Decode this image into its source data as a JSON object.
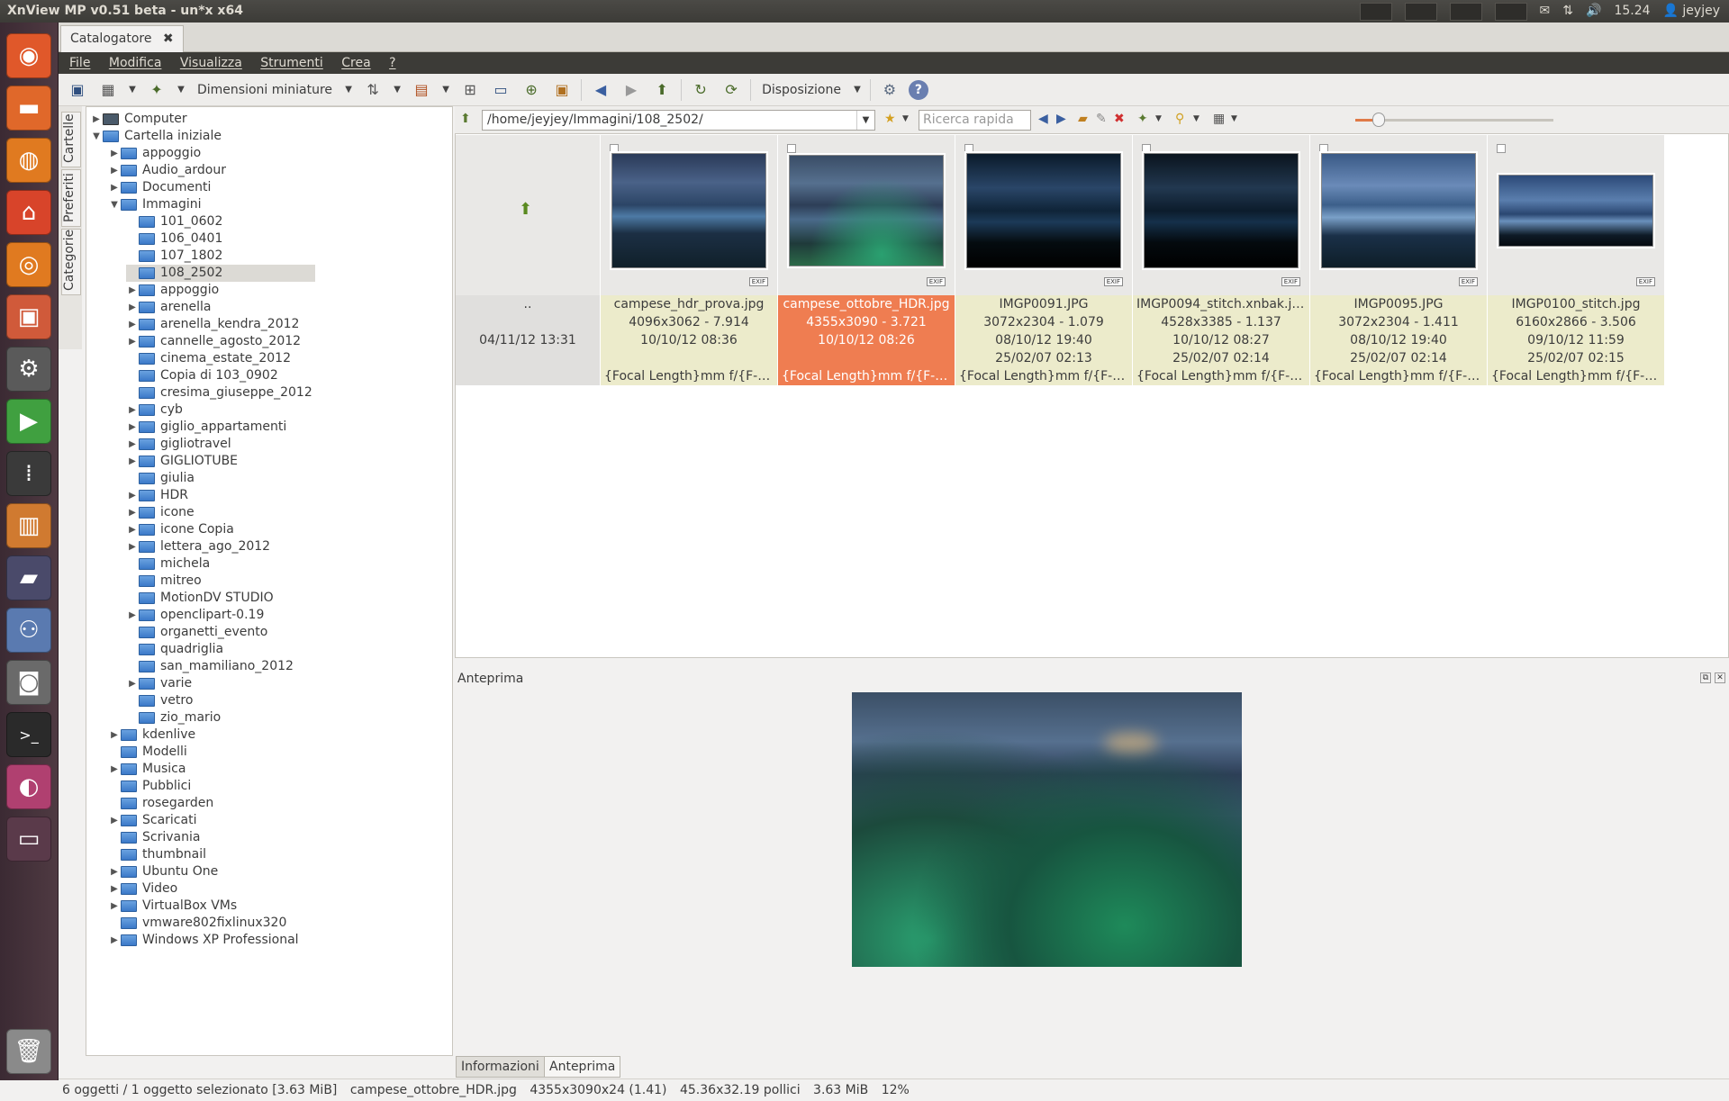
{
  "topbar": {
    "window_title": "XnView MP v0.51 beta - un*x x64",
    "clock": "15.24",
    "user": "jeyjey"
  },
  "launcher": {
    "items": [
      "ubuntu-dash",
      "files",
      "firefox",
      "software-center",
      "xnview",
      "image-viewer",
      "settings",
      "media-player",
      "binary",
      "monitor",
      "video-editor",
      "photo-manager",
      "camera",
      "terminal",
      "color-picker",
      "workspace"
    ]
  },
  "tabs": {
    "catalog_label": "Catalogatore",
    "close_glyph": "✖"
  },
  "menu": [
    "File",
    "Modifica",
    "Visualizza",
    "Strumenti",
    "Crea",
    "?"
  ],
  "toolbar": {
    "thumb_size_label": "Dimensioni miniature",
    "layout_label": "Disposizione"
  },
  "side_tabs": [
    "Cartelle",
    "Preferiti",
    "Categorie"
  ],
  "tree": [
    {
      "label": "Computer",
      "level": 0,
      "arrow": "right",
      "icon": "computer"
    },
    {
      "label": "Cartella iniziale",
      "level": 0,
      "arrow": "down",
      "icon": "folder"
    },
    {
      "label": "appoggio",
      "level": 1,
      "arrow": "right",
      "icon": "folder"
    },
    {
      "label": "Audio_ardour",
      "level": 1,
      "arrow": "right",
      "icon": "folder"
    },
    {
      "label": "Documenti",
      "level": 1,
      "arrow": "right",
      "icon": "folder"
    },
    {
      "label": "Immagini",
      "level": 1,
      "arrow": "down",
      "icon": "folder"
    },
    {
      "label": "101_0602",
      "level": 2,
      "arrow": "",
      "icon": "folder"
    },
    {
      "label": "106_0401",
      "level": 2,
      "arrow": "",
      "icon": "folder"
    },
    {
      "label": "107_1802",
      "level": 2,
      "arrow": "",
      "icon": "folder"
    },
    {
      "label": "108_2502",
      "level": 2,
      "arrow": "",
      "icon": "folder",
      "selected": true
    },
    {
      "label": "appoggio",
      "level": 2,
      "arrow": "right",
      "icon": "folder"
    },
    {
      "label": "arenella",
      "level": 2,
      "arrow": "right",
      "icon": "folder"
    },
    {
      "label": "arenella_kendra_2012",
      "level": 2,
      "arrow": "right",
      "icon": "folder"
    },
    {
      "label": "cannelle_agosto_2012",
      "level": 2,
      "arrow": "right",
      "icon": "folder"
    },
    {
      "label": "cinema_estate_2012",
      "level": 2,
      "arrow": "",
      "icon": "folder"
    },
    {
      "label": "Copia di 103_0902",
      "level": 2,
      "arrow": "",
      "icon": "folder"
    },
    {
      "label": "cresima_giuseppe_2012",
      "level": 2,
      "arrow": "",
      "icon": "folder"
    },
    {
      "label": "cyb",
      "level": 2,
      "arrow": "right",
      "icon": "folder"
    },
    {
      "label": "giglio_appartamenti",
      "level": 2,
      "arrow": "right",
      "icon": "folder"
    },
    {
      "label": "gigliotravel",
      "level": 2,
      "arrow": "right",
      "icon": "folder"
    },
    {
      "label": "GIGLIOTUBE",
      "level": 2,
      "arrow": "right",
      "icon": "folder"
    },
    {
      "label": "giulia",
      "level": 2,
      "arrow": "",
      "icon": "folder"
    },
    {
      "label": "HDR",
      "level": 2,
      "arrow": "right",
      "icon": "folder"
    },
    {
      "label": "icone",
      "level": 2,
      "arrow": "right",
      "icon": "folder"
    },
    {
      "label": "icone Copia",
      "level": 2,
      "arrow": "right",
      "icon": "folder"
    },
    {
      "label": "lettera_ago_2012",
      "level": 2,
      "arrow": "right",
      "icon": "folder"
    },
    {
      "label": "michela",
      "level": 2,
      "arrow": "",
      "icon": "folder"
    },
    {
      "label": "mitreo",
      "level": 2,
      "arrow": "",
      "icon": "folder"
    },
    {
      "label": "MotionDV STUDIO",
      "level": 2,
      "arrow": "",
      "icon": "folder"
    },
    {
      "label": "openclipart-0.19",
      "level": 2,
      "arrow": "right",
      "icon": "folder"
    },
    {
      "label": "organetti_evento",
      "level": 2,
      "arrow": "",
      "icon": "folder"
    },
    {
      "label": "quadriglia",
      "level": 2,
      "arrow": "",
      "icon": "folder"
    },
    {
      "label": "san_mamiliano_2012",
      "level": 2,
      "arrow": "",
      "icon": "folder"
    },
    {
      "label": "varie",
      "level": 2,
      "arrow": "right",
      "icon": "folder"
    },
    {
      "label": "vetro",
      "level": 2,
      "arrow": "",
      "icon": "folder"
    },
    {
      "label": "zio_mario",
      "level": 2,
      "arrow": "",
      "icon": "folder"
    },
    {
      "label": "kdenlive",
      "level": 1,
      "arrow": "right",
      "icon": "folder"
    },
    {
      "label": "Modelli",
      "level": 1,
      "arrow": "",
      "icon": "folder"
    },
    {
      "label": "Musica",
      "level": 1,
      "arrow": "right",
      "icon": "folder"
    },
    {
      "label": "Pubblici",
      "level": 1,
      "arrow": "",
      "icon": "folder"
    },
    {
      "label": "rosegarden",
      "level": 1,
      "arrow": "",
      "icon": "folder"
    },
    {
      "label": "Scaricati",
      "level": 1,
      "arrow": "right",
      "icon": "folder"
    },
    {
      "label": "Scrivania",
      "level": 1,
      "arrow": "",
      "icon": "folder"
    },
    {
      "label": "thumbnail",
      "level": 1,
      "arrow": "",
      "icon": "folder"
    },
    {
      "label": "Ubuntu One",
      "level": 1,
      "arrow": "right",
      "icon": "folder"
    },
    {
      "label": "Video",
      "level": 1,
      "arrow": "right",
      "icon": "folder"
    },
    {
      "label": "VirtualBox VMs",
      "level": 1,
      "arrow": "right",
      "icon": "folder"
    },
    {
      "label": "vmware802fixlinux320",
      "level": 1,
      "arrow": "",
      "icon": "folder"
    },
    {
      "label": "Windows XP Professional",
      "level": 1,
      "arrow": "right",
      "icon": "folder"
    }
  ],
  "address": {
    "path": "/home/jeyjey/Immagini/108_2502/",
    "search_placeholder": "Ricerca rapida",
    "zoom_fraction": 0.12
  },
  "parent_entry": {
    "name": "..",
    "date": "04/11/12 13:31"
  },
  "files": [
    {
      "name": "campese_hdr_prova.jpg",
      "dims": "4096x3062 - 7.914",
      "date1": "10/10/12 08:36",
      "date2": "",
      "exif": "{Focal Length}mm f/{F-Nu...",
      "selected": false
    },
    {
      "name": "campese_ottobre_HDR.jpg",
      "dims": "4355x3090 - 3.721",
      "date1": "10/10/12 08:26",
      "date2": "",
      "exif": "{Focal Length}mm f/{F-Nu...",
      "selected": true
    },
    {
      "name": "IMGP0091.JPG",
      "dims": "3072x2304 - 1.079",
      "date1": "08/10/12 19:40",
      "date2": "25/02/07 02:13",
      "exif": "{Focal Length}mm f/{F-Nu...",
      "selected": false
    },
    {
      "name": "IMGP0094_stitch.xnbak.jpg",
      "dims": "4528x3385 - 1.137",
      "date1": "10/10/12 08:27",
      "date2": "25/02/07 02:14",
      "exif": "{Focal Length}mm f/{F-Nu...",
      "selected": false
    },
    {
      "name": "IMGP0095.JPG",
      "dims": "3072x2304 - 1.411",
      "date1": "08/10/12 19:40",
      "date2": "25/02/07 02:14",
      "exif": "{Focal Length}mm f/{F-Nu...",
      "selected": false
    },
    {
      "name": "IMGP0100_stitch.jpg",
      "dims": "6160x2866 - 3.506",
      "date1": "09/10/12 11:59",
      "date2": "25/02/07 02:15",
      "exif": "{Focal Length}mm f/{F-Nu...",
      "selected": false
    }
  ],
  "exif_badge": "EXIF",
  "preview": {
    "title": "Anteprima"
  },
  "bottom_tabs": [
    "Informazioni",
    "Anteprima"
  ],
  "status": {
    "count": "6 oggetti / 1 oggetto selezionato [3.63 MiB]",
    "file": "campese_ottobre_HDR.jpg",
    "dims": "4355x3090x24 (1.41)",
    "inches": "45.36x32.19 pollici",
    "size": "3.63 MiB",
    "zoom": "12%"
  },
  "colors": {
    "selection": "#ef7d51",
    "info_bg": "#ecebcb",
    "menubar": "#3c3b37"
  }
}
